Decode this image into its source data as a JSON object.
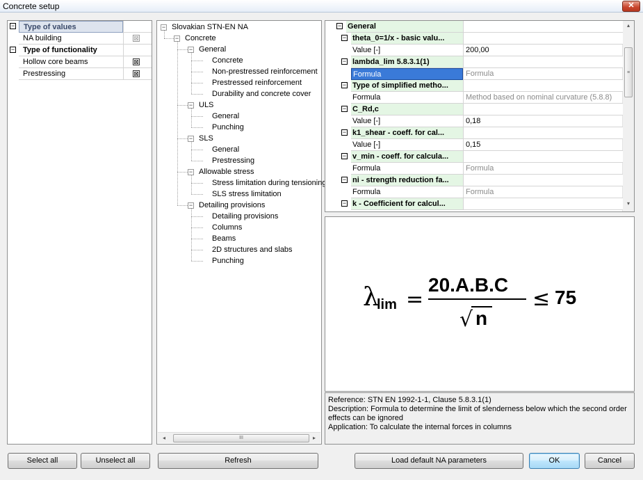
{
  "window": {
    "title": "Concrete setup",
    "close_glyph": "✕"
  },
  "left_list": {
    "rows": [
      {
        "label": "Type of values",
        "kind": "group",
        "selected": true,
        "expander": "−"
      },
      {
        "label": "NA building",
        "kind": "item",
        "check": "⊠",
        "dim": true
      },
      {
        "label": "Type of functionality",
        "kind": "group",
        "expander": "−"
      },
      {
        "label": "Hollow core beams",
        "kind": "item",
        "check": "⊠"
      },
      {
        "label": "Prestressing",
        "kind": "item",
        "check": "⊠"
      }
    ]
  },
  "tree": {
    "root": "Slovakian STN-EN NA",
    "concrete": "Concrete",
    "general": "General",
    "general_items": [
      "Concrete",
      "Non-prestressed reinforcement",
      "Prestressed reinforcement",
      "Durability and concrete cover"
    ],
    "uls": "ULS",
    "uls_items": [
      "General",
      "Punching"
    ],
    "sls": "SLS",
    "sls_items": [
      "General",
      "Prestressing"
    ],
    "allowable": "Allowable stress",
    "allowable_items": [
      "Stress limitation during tensioning",
      "SLS stress limitation"
    ],
    "detailing": "Detailing provisions",
    "detailing_items": [
      "Detailing provisions",
      "Columns",
      "Beams",
      "2D structures and slabs",
      "Punching"
    ],
    "collapse_glyph": "−",
    "scroll_left": "◂",
    "scroll_right": "▸",
    "thumb_grip": "III"
  },
  "properties": {
    "rows": [
      {
        "kind": "top",
        "label": "General",
        "value": ""
      },
      {
        "kind": "group",
        "label": "theta_0=1/x - basic valu...",
        "value": ""
      },
      {
        "kind": "item",
        "label": "Value [-]",
        "value": "200,00"
      },
      {
        "kind": "group",
        "label": "lambda_lim 5.8.3.1(1)",
        "value": ""
      },
      {
        "kind": "item",
        "label": "Formula",
        "value": "Formula",
        "dim": true,
        "selected": true
      },
      {
        "kind": "group",
        "label": "Type of  simplified metho...",
        "value": ""
      },
      {
        "kind": "item",
        "label": "Formula",
        "value": "Method based on nominal curvature (5.8.8)",
        "dim": true
      },
      {
        "kind": "group",
        "label": "C_Rd,c",
        "value": ""
      },
      {
        "kind": "item",
        "label": "Value [-]",
        "value": "0,18"
      },
      {
        "kind": "group",
        "label": "k1_shear - coeff. for cal...",
        "value": ""
      },
      {
        "kind": "item",
        "label": "Value [-]",
        "value": "0,15"
      },
      {
        "kind": "group",
        "label": "v_min - coeff. for calcula...",
        "value": ""
      },
      {
        "kind": "item",
        "label": "Formula",
        "value": "Formula",
        "dim": true
      },
      {
        "kind": "group",
        "label": "ni - strength reduction fa...",
        "value": ""
      },
      {
        "kind": "item",
        "label": "Formula",
        "value": "Formula",
        "dim": true
      },
      {
        "kind": "group",
        "label": "k - Coefficient for calcul...",
        "value": ""
      }
    ],
    "expander": "−",
    "scroll_up": "▴",
    "scroll_down": "▾",
    "thumb_grip": "≡"
  },
  "formula": {
    "lambda": "λ",
    "subscript": "lim",
    "equals": "=",
    "numerator": "20.A.B.C",
    "radical": "√",
    "denominator": "n",
    "leq": "≤",
    "limit": "75"
  },
  "description": {
    "reference": "Reference:  STN EN 1992-1-1, Clause 5.8.3.1(1)",
    "description_l1": "Description:  Formula to determine the limit of slenderness below which the second order",
    "description_l2": "effects can be ignored",
    "application": "Application:  To calculate the internal forces in columns"
  },
  "buttons": {
    "select_all": "Select all",
    "unselect_all": "Unselect all",
    "refresh": "Refresh",
    "load_default": "Load default NA parameters",
    "ok": "OK",
    "cancel": "Cancel"
  }
}
